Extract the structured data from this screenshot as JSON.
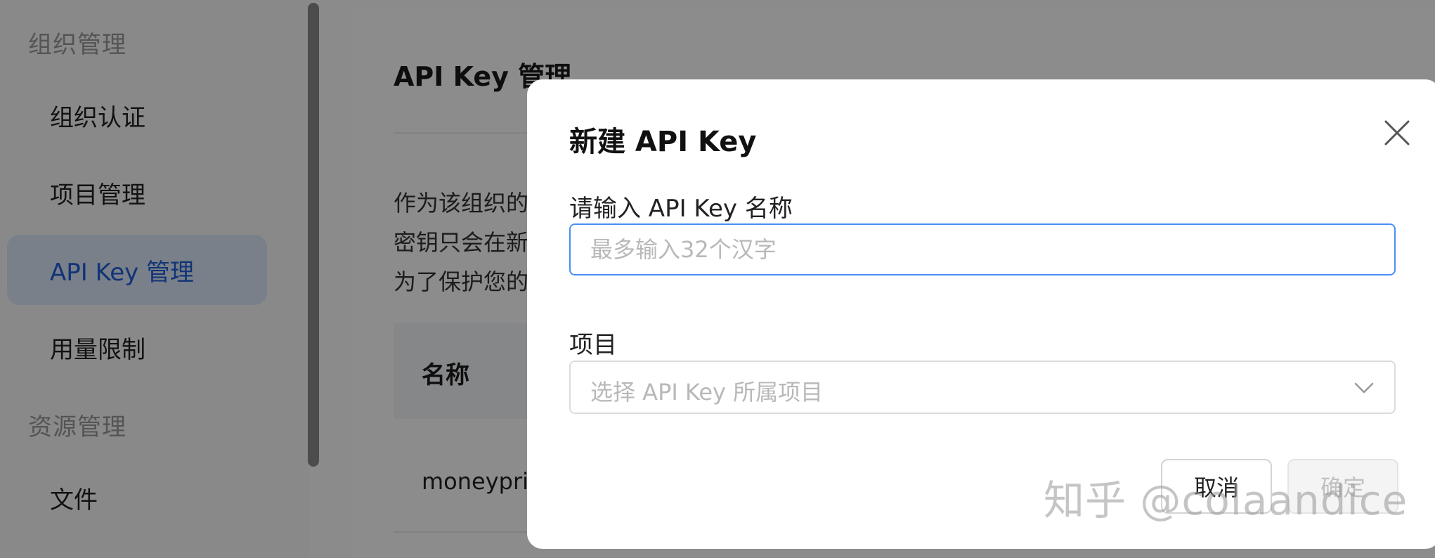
{
  "sidebar": {
    "section_org": "组织管理",
    "section_resource": "资源管理",
    "items": [
      {
        "label": "组织认证"
      },
      {
        "label": "项目管理"
      },
      {
        "label": "API Key 管理"
      },
      {
        "label": "用量限制"
      },
      {
        "label": "文件"
      }
    ]
  },
  "main": {
    "title": "API Key 管理",
    "description_lines": [
      "作为该组织的",
      "密钥只会在新",
      "为了保护您的"
    ],
    "table": {
      "header_name": "名称",
      "rows": [
        {
          "name": "moneypri"
        }
      ]
    }
  },
  "modal": {
    "title": "新建 API Key",
    "name_label": "请输入 API Key 名称",
    "name_placeholder": "最多输入32个汉字",
    "project_label": "项目",
    "project_placeholder": "选择 API Key 所属项目",
    "cancel_label": "取消",
    "confirm_label": "确定"
  },
  "watermark": "知乎 @colaandice",
  "colors": {
    "accent": "#4a8df5",
    "active_nav_bg": "#dde9fb",
    "active_nav_text": "#1f5fd8"
  }
}
